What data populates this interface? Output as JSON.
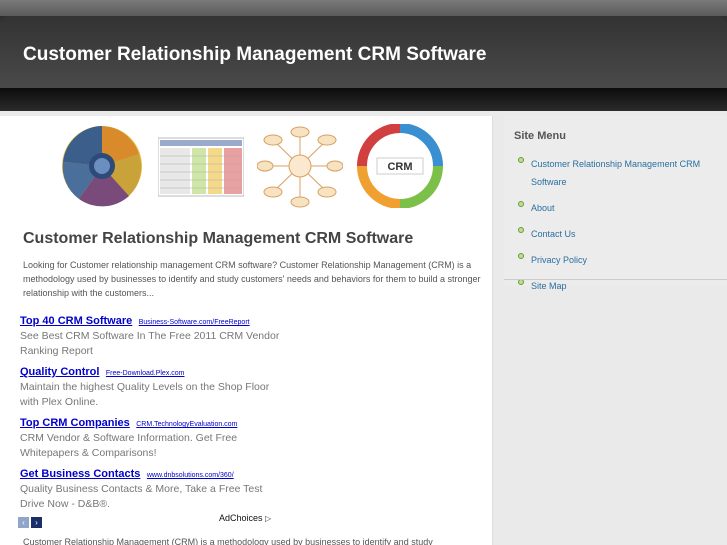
{
  "header": {
    "site_title": "Customer Relationship Management CRM Software"
  },
  "banner": {
    "images": [
      {
        "icon": "crm-cycle-wheel-icon"
      },
      {
        "icon": "crm-comparison-table-icon"
      },
      {
        "icon": "crm-hub-diagram-icon"
      },
      {
        "icon": "crm-process-cycle-icon",
        "label": "CRM"
      }
    ]
  },
  "post": {
    "title": "Customer Relationship Management CRM Software",
    "excerpt": "Looking for Customer relationship management CRM software? Customer Relationship Management (CRM) is a methodology used by businesses to identify and study customers' needs and behaviors for them to build a stronger relationship with the customers..."
  },
  "ads": [
    {
      "title": "Top 40 CRM Software",
      "domain": "Business-Software.com/FreeReport",
      "desc": "See Best CRM Software In The Free 2011 CRM Vendor Ranking Report"
    },
    {
      "title": "Quality Control",
      "domain": "Free-Download.Plex.com",
      "desc": "Maintain the highest Quality Levels on the Shop Floor with Plex Online."
    },
    {
      "title": "Top CRM Companies",
      "domain": "CRM.TechnologyEvaluation.com",
      "desc": "CRM Vendor & Software Information. Get Free Whitepapers & Comparisons!"
    },
    {
      "title": "Get Business Contacts",
      "domain": "www.dnbsolutions.com/360/",
      "desc": "Quality Business Contacts & More, Take a Free Test Drive Now - D&B®."
    }
  ],
  "ad_nav": {
    "prev": "‹",
    "next": "›",
    "adchoices": "AdChoices",
    "adchoices_icon": "▷"
  },
  "bottom_text": "Customer Relationship Management (CRM) is a methodology used by businesses to identify and study",
  "sidebar": {
    "heading": "Site Menu",
    "items": [
      {
        "label": "Customer Relationship Management CRM Software"
      },
      {
        "label": "About"
      },
      {
        "label": "Contact Us"
      },
      {
        "label": "Privacy Policy"
      },
      {
        "label": "Site Map"
      }
    ]
  },
  "colors": {
    "link": "#0000cc",
    "sidebar_link": "#2a6fa0",
    "bullet": "#8cc24a"
  }
}
